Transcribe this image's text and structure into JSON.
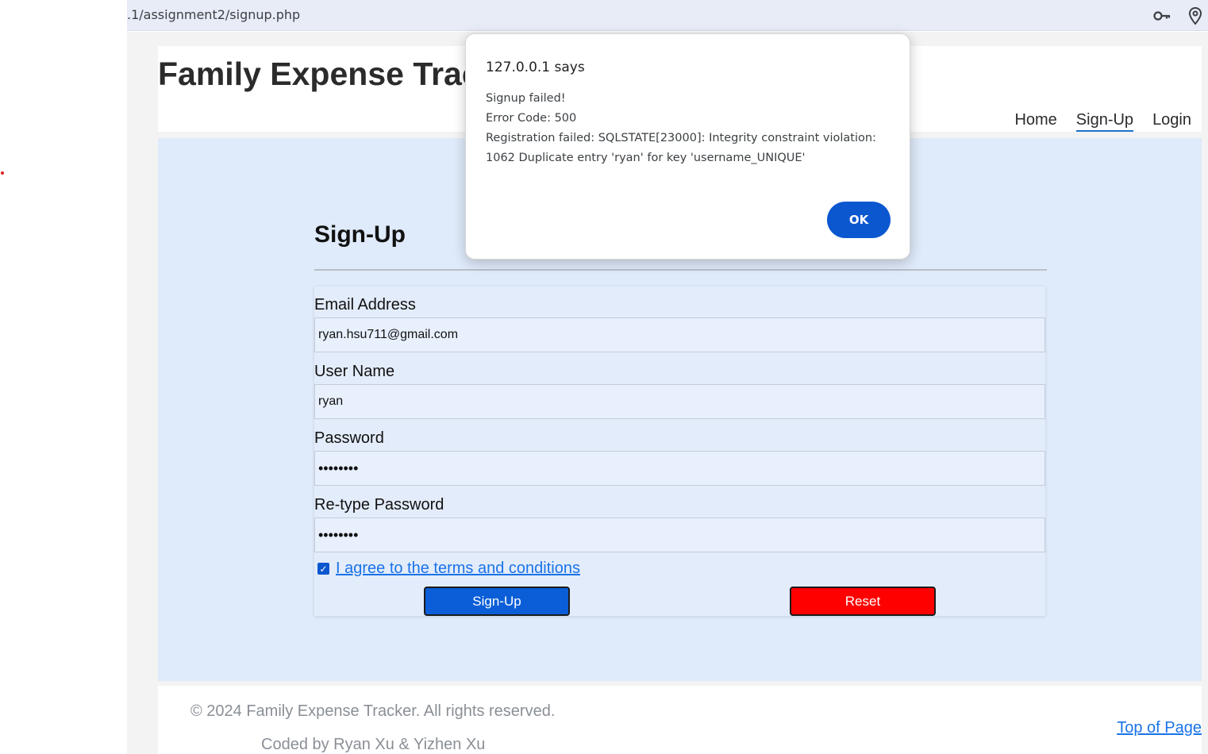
{
  "browser": {
    "url": ".1/assignment2/signup.php",
    "icons": [
      "key-icon",
      "location-pin-icon"
    ]
  },
  "header": {
    "site_title": "Family Expense Trac",
    "nav": [
      {
        "label": "Home",
        "active": false
      },
      {
        "label": "Sign-Up",
        "active": true
      },
      {
        "label": "Login",
        "active": false
      }
    ]
  },
  "form": {
    "title": "Sign-Up",
    "email_label": "Email Address",
    "email_value": "ryan.hsu711@gmail.com",
    "username_label": "User Name",
    "username_value": "ryan",
    "password_label": "Password",
    "password_value": "••••••••",
    "retype_label": "Re-type Password",
    "retype_value": "••••••••",
    "terms_checked": true,
    "terms_label": "I agree to the terms and conditions",
    "signup_button": "Sign-Up",
    "reset_button": "Reset"
  },
  "footer": {
    "copyright": "© 2024 Family Expense Tracker. All rights reserved.",
    "coded_by": "Coded by Ryan Xu & Yizhen Xu",
    "top_link": "Top of Page"
  },
  "dialog": {
    "title": "127.0.0.1 says",
    "line1": "Signup failed!",
    "line2": "Error Code: 500",
    "line3": "Registration failed: SQLSTATE[23000]: Integrity constraint violation:",
    "line4": "1062 Duplicate entry 'ryan' for key 'username_UNIQUE'",
    "ok_button": "OK"
  },
  "colors": {
    "accent_blue": "#0b57d0",
    "reset_red": "#ff0000",
    "main_bg": "#dfeafa"
  }
}
